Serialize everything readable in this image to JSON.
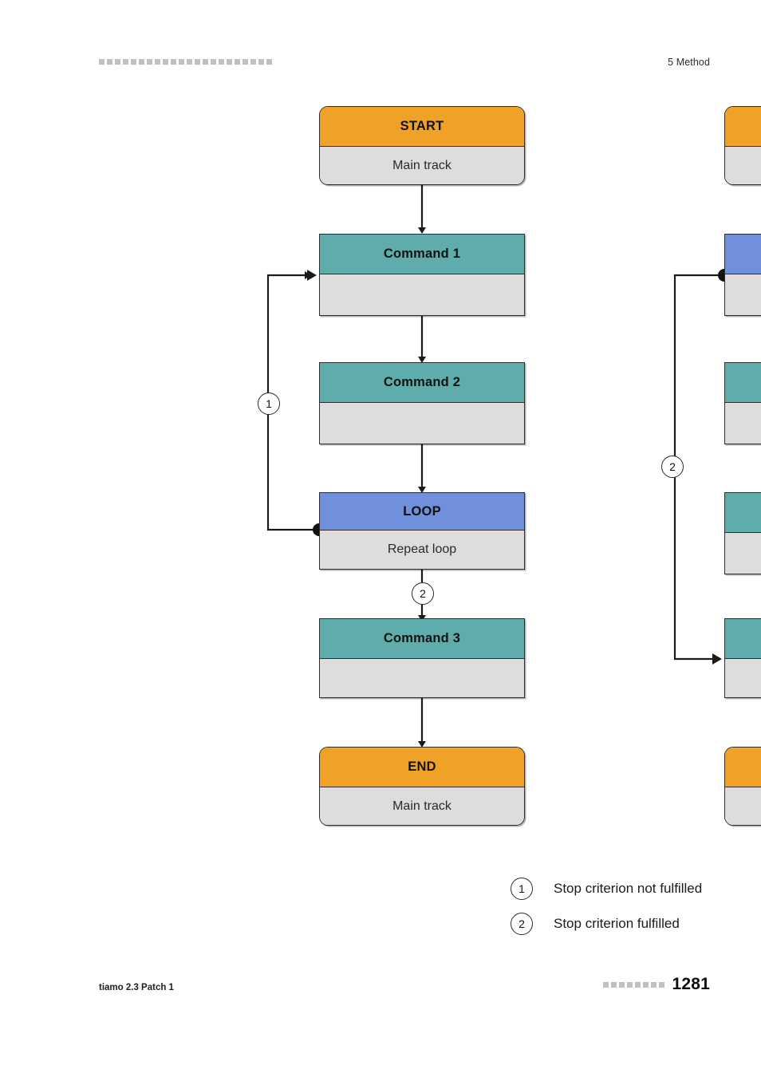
{
  "header": {
    "chapter": "5 Method",
    "rule_square_count": 22
  },
  "footer": {
    "product": "tiamo 2.3 Patch 1",
    "page_number": "1281",
    "rule_square_count": 8
  },
  "colors": {
    "start_end_header": "#f0a228",
    "command_header": "#5facac",
    "loop_header": "#7190dc",
    "body": "#dedddb",
    "outline": "#2e2e2e",
    "connector": "#1a1a1a"
  },
  "main_flow": {
    "nodes": [
      {
        "id": "start",
        "title": "START",
        "subtitle": "Main track",
        "style": "start",
        "shape": "round"
      },
      {
        "id": "command1",
        "title": "Command 1",
        "subtitle": "",
        "style": "cmd",
        "shape": "square"
      },
      {
        "id": "command2",
        "title": "Command 2",
        "subtitle": "",
        "style": "cmd",
        "shape": "square"
      },
      {
        "id": "loop",
        "title": "LOOP",
        "subtitle": "Repeat loop",
        "style": "loop",
        "shape": "square"
      },
      {
        "id": "command3",
        "title": "Command 3",
        "subtitle": "",
        "style": "cmd",
        "shape": "square"
      },
      {
        "id": "end",
        "title": "END",
        "subtitle": "Main track",
        "style": "start",
        "shape": "round"
      }
    ],
    "markers": [
      {
        "id": "marker-1",
        "label": "1",
        "on": "loop-back-branch to Command 1"
      },
      {
        "id": "marker-2",
        "label": "2",
        "on": "loop to Command 3"
      }
    ]
  },
  "secondary_flow": {
    "note": "partially cropped second flowchart at right page edge",
    "nodes": [
      {
        "id": "start",
        "style": "start",
        "shape": "round"
      },
      {
        "id": "loop",
        "style": "loop",
        "shape": "square"
      },
      {
        "id": "command1",
        "style": "cmd",
        "shape": "square"
      },
      {
        "id": "command2",
        "style": "cmd",
        "shape": "square"
      },
      {
        "id": "command3",
        "style": "cmd",
        "shape": "square"
      },
      {
        "id": "end",
        "style": "start",
        "shape": "round"
      }
    ],
    "markers": [
      {
        "id": "marker-2",
        "label": "2",
        "on": "loop bypass to third command"
      }
    ]
  },
  "legend": {
    "items": [
      {
        "symbol": "1",
        "text": "Stop criterion not fulfilled"
      },
      {
        "symbol": "2",
        "text": "Stop criterion fulfilled"
      }
    ]
  }
}
